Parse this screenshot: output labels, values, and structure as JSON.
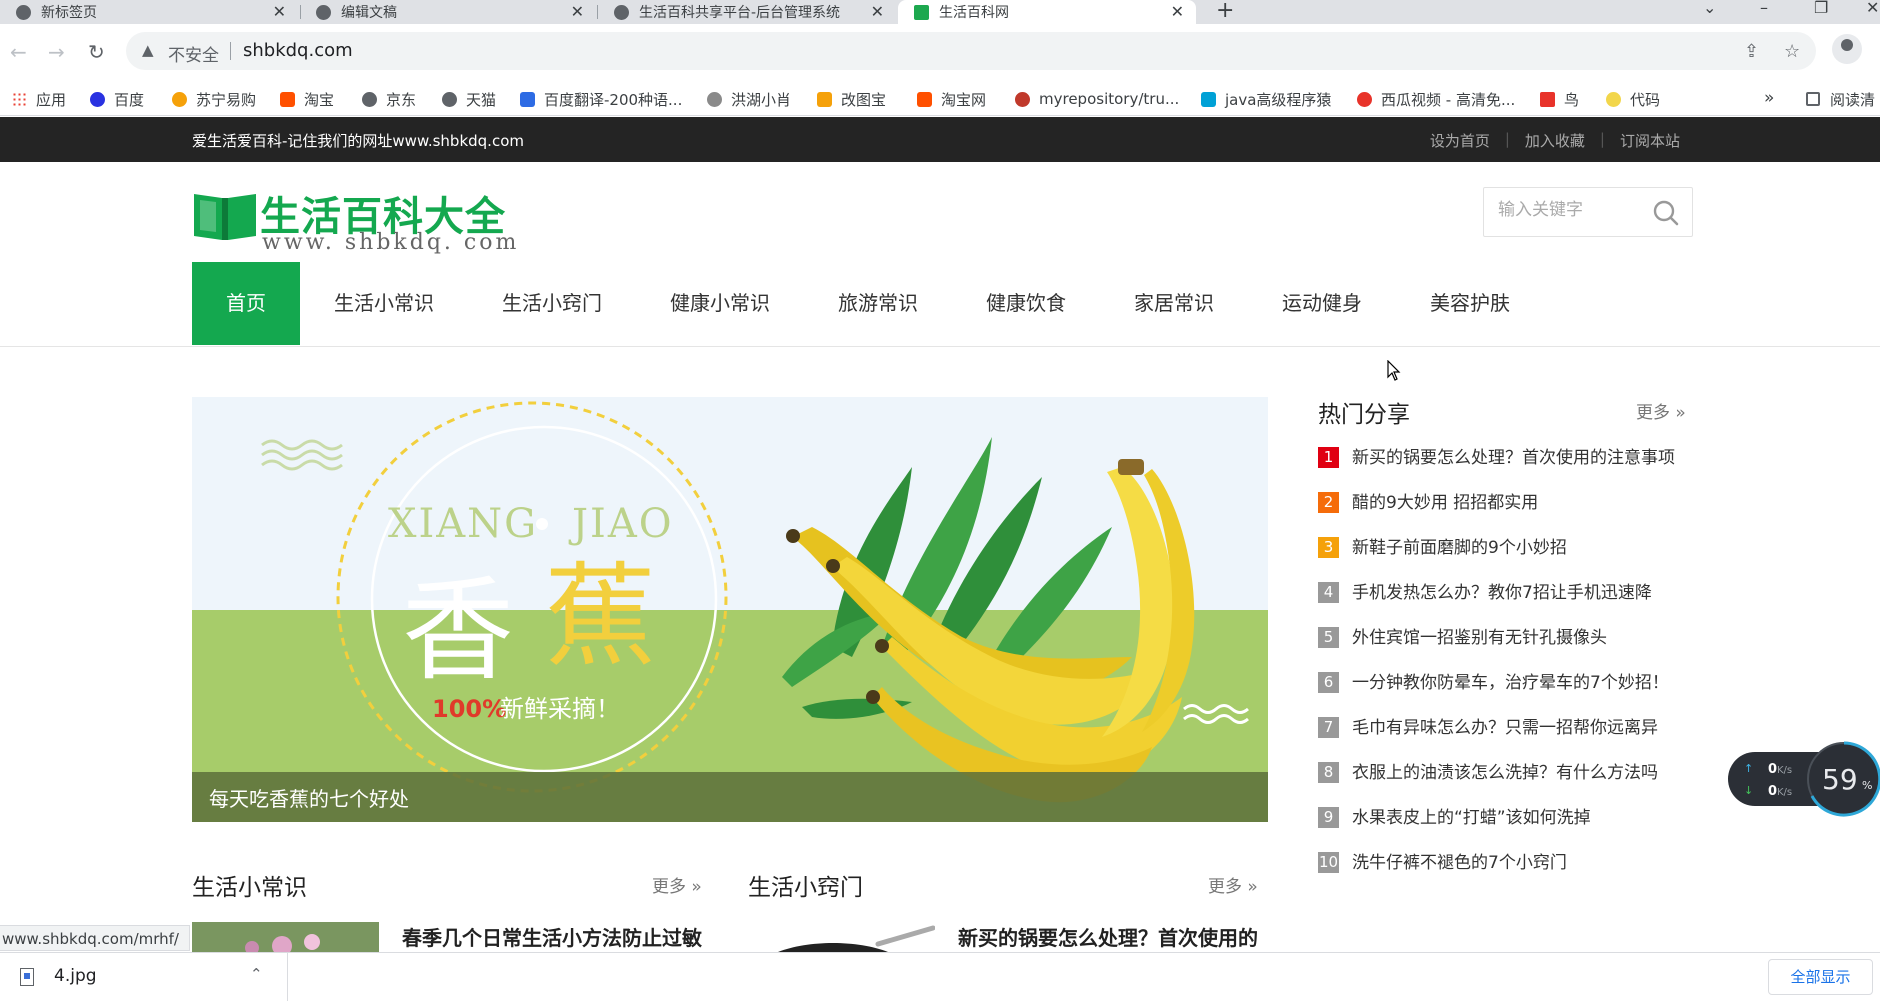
{
  "browser": {
    "tabs": [
      {
        "title": "新标签页",
        "active": false
      },
      {
        "title": "编辑文稿",
        "active": false
      },
      {
        "title": "生活百科共享平台-后台管理系统",
        "active": false
      },
      {
        "title": "生活百科网",
        "active": true
      }
    ],
    "close_glyph": "✕",
    "new_tab_glyph": "+",
    "address": {
      "security_label": "不安全",
      "url": "shbkdq.com"
    },
    "bookmarks": [
      {
        "label": "应用",
        "color": "#e94235"
      },
      {
        "label": "百度",
        "color": "#2932e1"
      },
      {
        "label": "苏宁易购",
        "color": "#f5a10a"
      },
      {
        "label": "淘宝",
        "color": "#ff5000"
      },
      {
        "label": "京东",
        "color": "#5f6368"
      },
      {
        "label": "天猫",
        "color": "#5f6368"
      },
      {
        "label": "百度翻译-200种语...",
        "color": "#2d6be4"
      },
      {
        "label": "洪湖小肖",
        "color": "#8a8a8a"
      },
      {
        "label": "改图宝",
        "color": "#f5a10a"
      },
      {
        "label": "淘宝网",
        "color": "#ff5000"
      },
      {
        "label": "myrepository/tru...",
        "color": "#c0392b"
      },
      {
        "label": "java高级程序猿",
        "color": "#00a1d6"
      },
      {
        "label": "西瓜视频 - 高清免...",
        "color": "#e8332a"
      },
      {
        "label": "鸟",
        "color": "#e8332a"
      },
      {
        "label": "代码",
        "color": "#f2d64b"
      }
    ],
    "bookmarks_more": "»",
    "reading_list": "阅读清"
  },
  "site": {
    "slogan": "爱生活爱百科-记住我们的网址www.shbkdq.com",
    "top_links": [
      "设为首页",
      "加入收藏",
      "订阅本站"
    ],
    "logo_title": "生活百科大全",
    "logo_url": "www. shbkdq. com",
    "search_placeholder": "输入关键字",
    "nav": [
      "首页",
      "生活小常识",
      "生活小窍门",
      "健康小常识",
      "旅游常识",
      "健康饮食",
      "家居常识",
      "运动健身",
      "美容护肤"
    ],
    "banner": {
      "caption": "每天吃香蕉的七个好处",
      "en_left": "XIANG",
      "en_right": "JIAO",
      "cn_left": "香",
      "cn_right": "蕉",
      "percent": "100%",
      "tagline": "新鲜采摘！"
    },
    "hot": {
      "title": "热门分享",
      "more": "更多",
      "items": [
        "新买的锅要怎么处理？首次使用的注意事项",
        "醋的9大妙用 招招都实用",
        "新鞋子前面磨脚的9个小妙招",
        "手机发热怎么办？教你7招让手机迅速降",
        "外住宾馆一招鉴别有无针孔摄像头",
        "一分钟教你防晕车，治疗晕车的7个妙招！",
        "毛巾有异味怎么办？只需一招帮你远离异",
        "衣服上的油渍该怎么洗掉？有什么方法吗",
        "水果表皮上的“打蜡”该如何洗掉",
        "洗牛仔裤不褪色的7个小窍门"
      ]
    },
    "sections": [
      {
        "title": "生活小常识",
        "more": "更多",
        "article": "春季几个日常生活小方法防止过敏"
      },
      {
        "title": "生活小窍门",
        "more": "更多",
        "article": "新买的锅要怎么处理？首次使用的"
      }
    ]
  },
  "status_url": "www.shbkdq.com/mrhf/",
  "downloads": {
    "file": "4.jpg",
    "show_all": "全部显示"
  },
  "speed": {
    "up": "0",
    "down": "0",
    "unit": "K/s",
    "percent": "59",
    "percent_unit": "%"
  },
  "colors": {
    "brand_green": "#14a84f",
    "dark_strip": "#242424"
  }
}
